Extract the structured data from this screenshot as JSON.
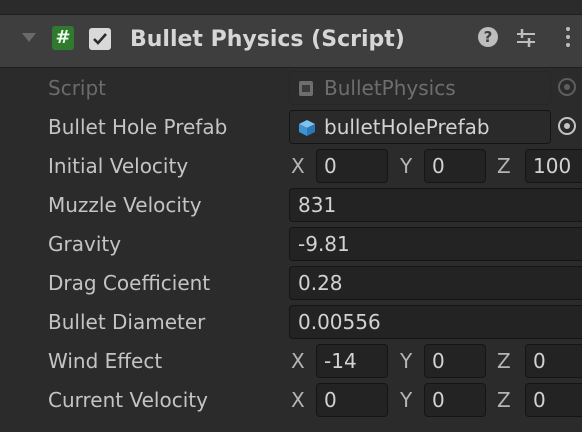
{
  "component": {
    "title": "Bullet Physics (Script)",
    "enabled": true
  },
  "fields": {
    "script": {
      "label": "Script",
      "value": "BulletPhysics"
    },
    "bullet_hole_prefab": {
      "label": "Bullet Hole Prefab",
      "value": "bulletHolePrefab"
    },
    "initial_velocity": {
      "label": "Initial Velocity",
      "x": "0",
      "y": "0",
      "z": "100"
    },
    "muzzle_velocity": {
      "label": "Muzzle Velocity",
      "value": "831"
    },
    "gravity": {
      "label": "Gravity",
      "value": "-9.81"
    },
    "drag_coefficient": {
      "label": "Drag Coefficient",
      "value": "0.28"
    },
    "bullet_diameter": {
      "label": "Bullet Diameter",
      "value": "0.00556"
    },
    "wind_effect": {
      "label": "Wind Effect",
      "x": "-14",
      "y": "0",
      "z": "0"
    },
    "current_velocity": {
      "label": "Current Velocity",
      "x": "0",
      "y": "0",
      "z": "0"
    }
  },
  "axis_labels": {
    "x": "X",
    "y": "Y",
    "z": "Z"
  },
  "icons": {
    "script_icon": "#",
    "help": "?",
    "colors": {
      "script_icon_bg": "#2f7a2f",
      "prefab_icon": "#4aa6e8"
    }
  }
}
